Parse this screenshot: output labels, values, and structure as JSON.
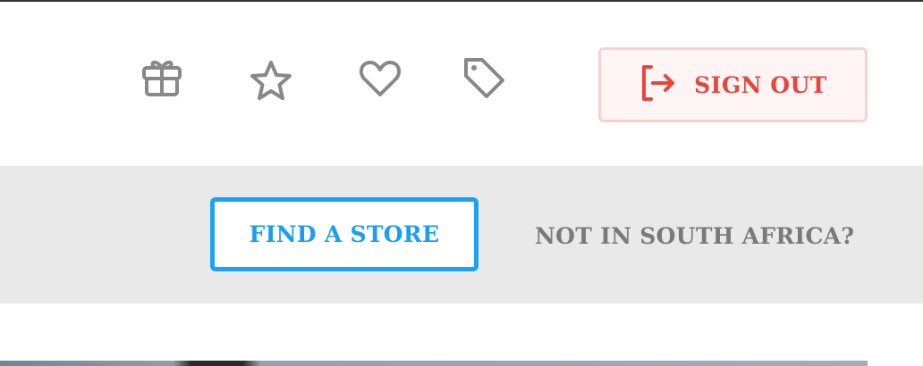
{
  "header": {
    "icons": {
      "gift": "gift-icon",
      "star": "star-icon",
      "heart": "heart-icon",
      "tag": "tag-icon"
    },
    "sign_out": {
      "label": "SIGN OUT",
      "icon": "sign-out-icon"
    }
  },
  "subbar": {
    "find_store_label": "FIND A STORE",
    "region_link_label": "NOT IN SOUTH AFRICA?"
  },
  "colors": {
    "icon_gray": "#888888",
    "sign_out_red": "#e8453c",
    "sign_out_border": "#f9d0d0",
    "find_store_blue": "#1aa3f5",
    "subbar_bg": "#e9e9e9",
    "region_gray": "#7a7a7a"
  }
}
